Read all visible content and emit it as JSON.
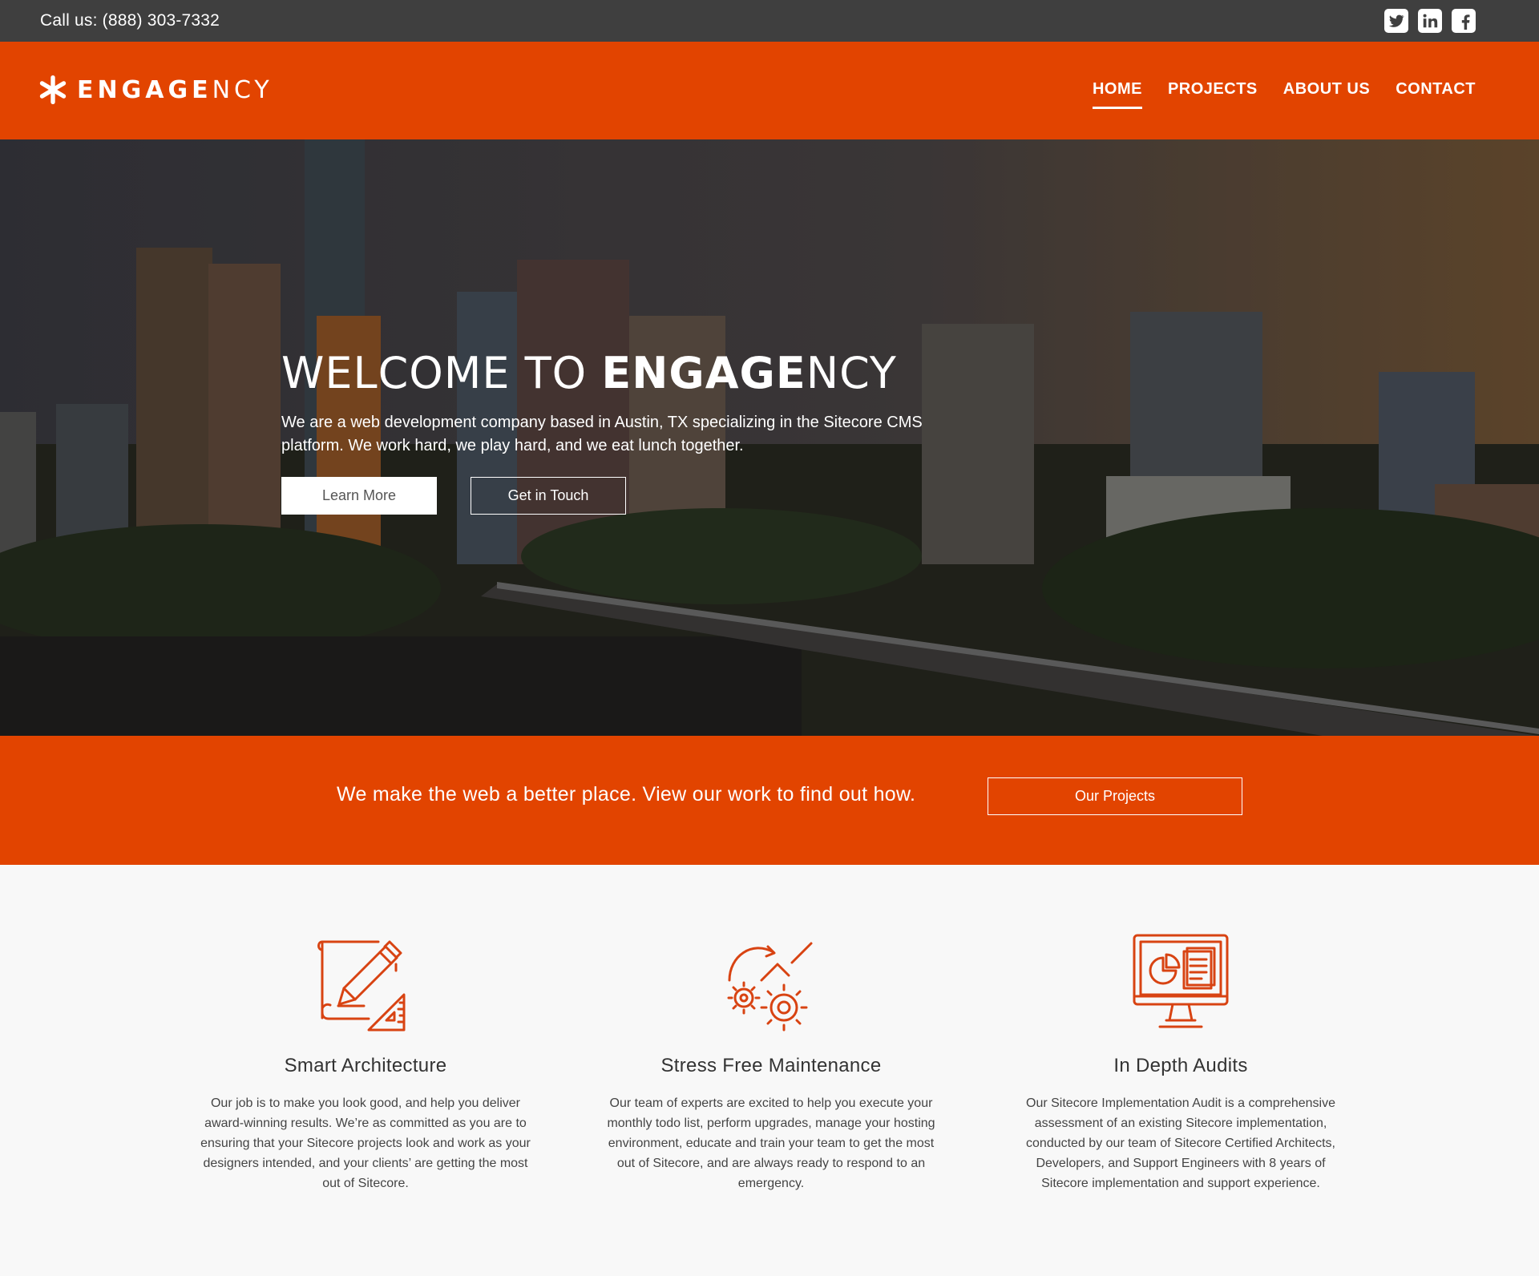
{
  "topbar": {
    "call": "Call us: (888) 303-7332",
    "socials": [
      "twitter-icon",
      "linkedin-icon",
      "facebook-icon"
    ]
  },
  "header": {
    "logo_bold": "ENGAGE",
    "logo_light": "NCY",
    "nav": [
      {
        "label": "HOME",
        "active": true
      },
      {
        "label": "PROJECTS",
        "active": false
      },
      {
        "label": "ABOUT US",
        "active": false
      },
      {
        "label": "CONTACT",
        "active": false
      }
    ]
  },
  "hero": {
    "title_light": "WELCOME TO ",
    "title_bold": "ENGAGE",
    "title_end": "NCY",
    "text": "We are a web development company based in Austin, TX specializing in the Sitecore CMS platform. We work hard, we play hard, and we eat lunch together.",
    "learn_more": "Learn More",
    "get_in_touch": "Get in Touch"
  },
  "band": {
    "text": "We make the web a better place. View our work to find out how.",
    "button": "Our Projects"
  },
  "features": [
    {
      "icon": "blueprint-pencil-icon",
      "title": "Smart Architecture",
      "text": "Our job is to make you look good, and help you deliver award-winning results. We’re as committed as you are to ensuring that your Sitecore projects look and work as your designers intended, and your clients’ are getting the most out of Sitecore."
    },
    {
      "icon": "gears-icon",
      "title": "Stress Free Maintenance",
      "text": "Our team of experts are excited to help you execute your monthly todo list, perform upgrades, manage your hosting environment, educate and train your team to get the most out of Sitecore, and are always ready to respond to an emergency."
    },
    {
      "icon": "monitor-report-icon",
      "title": "In Depth Audits",
      "text": "Our Sitecore Implementation Audit is a comprehensive assessment of an existing Sitecore implementation, conducted by our team of Sitecore Certified Architects, Developers, and Support Engineers with 8 years of Sitecore implementation and support experience."
    }
  ],
  "colors": {
    "brand_orange": "#e24400",
    "topbar_gray": "#3f3f3f",
    "icon_orange": "#d84312"
  }
}
